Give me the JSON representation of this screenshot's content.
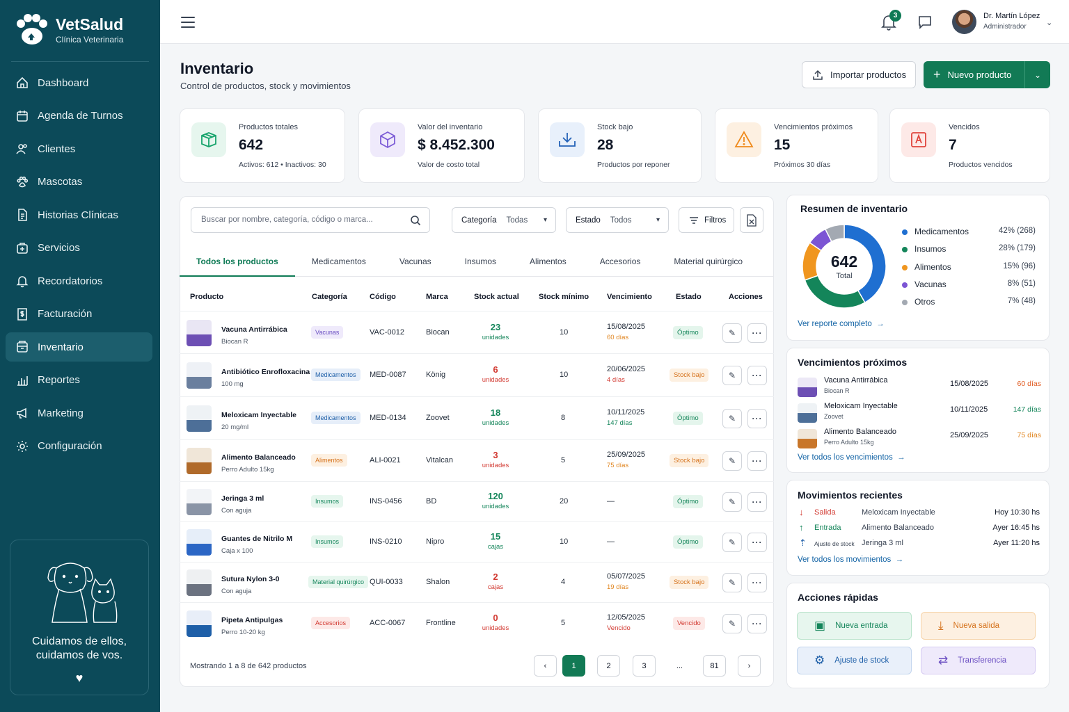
{
  "brand": {
    "name": "VetSalud",
    "subtitle": "Clínica Veterinaria"
  },
  "nav": [
    {
      "label": "Dashboard",
      "icon": "home-icon"
    },
    {
      "label": "Agenda de Turnos",
      "icon": "calendar-icon"
    },
    {
      "label": "Clientes",
      "icon": "users-icon"
    },
    {
      "label": "Mascotas",
      "icon": "paw-icon"
    },
    {
      "label": "Historias Clínicas",
      "icon": "document-icon"
    },
    {
      "label": "Servicios",
      "icon": "medical-plus-icon"
    },
    {
      "label": "Recordatorios",
      "icon": "bell-icon"
    },
    {
      "label": "Facturación",
      "icon": "invoice-icon"
    },
    {
      "label": "Inventario",
      "icon": "inventory-icon",
      "active": true
    },
    {
      "label": "Reportes",
      "icon": "bar-chart-icon"
    },
    {
      "label": "Marketing",
      "icon": "megaphone-icon"
    },
    {
      "label": "Configuración",
      "icon": "gear-icon"
    }
  ],
  "promo": {
    "text": "Cuidamos de ellos, cuidamos de vos."
  },
  "header": {
    "notifications": "3",
    "user_name": "Dr. Martín López",
    "user_role": "Administrador"
  },
  "page": {
    "title": "Inventario",
    "subtitle": "Control de productos, stock y movimientos",
    "import_label": "Importar productos",
    "new_label": "Nuevo producto"
  },
  "stats": [
    {
      "label": "Productos totales",
      "value": "642",
      "note": "Activos: 612 • Inactivos: 30",
      "icon": "box-icon",
      "color": "#16a36b",
      "bg": "#e6f6ee"
    },
    {
      "label": "Valor del inventario",
      "value": "$ 8.452.300",
      "note": "Valor de costo total",
      "icon": "cube-icon",
      "color": "#7c5cd6",
      "bg": "#efeafb"
    },
    {
      "label": "Stock bajo",
      "value": "28",
      "note": "Productos por reponer",
      "icon": "download-tray-icon",
      "color": "#2563b8",
      "bg": "#e8f0fb"
    },
    {
      "label": "Vencimientos próximos",
      "value": "15",
      "note": "Próximos 30 días",
      "icon": "warning-icon",
      "color": "#ef8a1c",
      "bg": "#fdf0e1"
    },
    {
      "label": "Vencidos",
      "value": "7",
      "note": "Productos vencidos",
      "icon": "expired-calendar-icon",
      "color": "#e0443c",
      "bg": "#fde9e7"
    }
  ],
  "filters": {
    "search_placeholder": "Buscar por nombre, categoría, código o marca...",
    "category_label": "Categoría",
    "category_value": "Todas",
    "status_label": "Estado",
    "status_value": "Todos",
    "filters_label": "Filtros"
  },
  "tabs": [
    "Todos los productos",
    "Medicamentos",
    "Vacunas",
    "Insumos",
    "Alimentos",
    "Accesorios",
    "Material quirúrgico"
  ],
  "columns": [
    "Producto",
    "Categoría",
    "Código",
    "Marca",
    "Stock actual",
    "Stock mínimo",
    "Vencimiento",
    "Estado",
    "Acciones"
  ],
  "products": [
    {
      "name": "Vacuna Antirrábica",
      "sub": "Biocan R",
      "category": "Vacunas",
      "code": "VAC-0012",
      "brand": "Biocan",
      "stock": "23",
      "unit": "unidades",
      "min": "10",
      "exp": "15/08/2025",
      "exp_note": "60 días",
      "status": "Óptimo",
      "stock_level": "ok",
      "exp_level": "warn",
      "cat_color": "#6b4fc2",
      "cat_bg": "#efeafb"
    },
    {
      "name": "Antibiótico Enrofloxacina",
      "sub": "100 mg",
      "category": "Medicamentos",
      "code": "MED-0087",
      "brand": "König",
      "stock": "6",
      "unit": "unidades",
      "min": "10",
      "exp": "20/06/2025",
      "exp_note": "4 días",
      "status": "Stock bajo",
      "stock_level": "low",
      "exp_level": "danger",
      "cat_color": "#1e5fa8",
      "cat_bg": "#e6eef9"
    },
    {
      "name": "Meloxicam Inyectable",
      "sub": "20 mg/ml",
      "category": "Medicamentos",
      "code": "MED-0134",
      "brand": "Zoovet",
      "stock": "18",
      "unit": "unidades",
      "min": "8",
      "exp": "10/11/2025",
      "exp_note": "147 días",
      "status": "Óptimo",
      "stock_level": "ok",
      "exp_level": "ok",
      "cat_color": "#1e5fa8",
      "cat_bg": "#e6eef9"
    },
    {
      "name": "Alimento Balanceado",
      "sub": "Perro Adulto 15kg",
      "category": "Alimentos",
      "code": "ALI-0021",
      "brand": "Vitalcan",
      "stock": "3",
      "unit": "unidades",
      "min": "5",
      "exp": "25/09/2025",
      "exp_note": "75 días",
      "status": "Stock bajo",
      "stock_level": "low",
      "exp_level": "warn",
      "cat_color": "#d5711a",
      "cat_bg": "#fdf0e1"
    },
    {
      "name": "Jeringa 3 ml",
      "sub": "Con aguja",
      "category": "Insumos",
      "code": "INS-0456",
      "brand": "BD",
      "stock": "120",
      "unit": "unidades",
      "min": "20",
      "exp": "—",
      "exp_note": "",
      "status": "Óptimo",
      "stock_level": "ok",
      "exp_level": "ok",
      "cat_color": "#15865c",
      "cat_bg": "#e6f6ee"
    },
    {
      "name": "Guantes de Nitrilo M",
      "sub": "Caja x 100",
      "category": "Insumos",
      "code": "INS-0210",
      "brand": "Nipro",
      "stock": "15",
      "unit": "cajas",
      "min": "10",
      "exp": "—",
      "exp_note": "",
      "status": "Óptimo",
      "stock_level": "ok",
      "exp_level": "ok",
      "cat_color": "#15865c",
      "cat_bg": "#e6f6ee"
    },
    {
      "name": "Sutura Nylon 3-0",
      "sub": "Con aguja",
      "category": "Material quirúrgico",
      "code": "QUI-0033",
      "brand": "Shalon",
      "stock": "2",
      "unit": "cajas",
      "min": "4",
      "exp": "05/07/2025",
      "exp_note": "19 días",
      "status": "Stock bajo",
      "stock_level": "low",
      "exp_level": "warn",
      "cat_color": "#15865c",
      "cat_bg": "#e6f6ee"
    },
    {
      "name": "Pipeta Antipulgas",
      "sub": "Perro 10-20 kg",
      "category": "Accesorios",
      "code": "ACC-0067",
      "brand": "Frontline",
      "stock": "0",
      "unit": "unidades",
      "min": "5",
      "exp": "12/05/2025",
      "exp_note": "Vencido",
      "status": "Vencido",
      "stock_level": "low",
      "exp_level": "danger",
      "cat_color": "#d23a32",
      "cat_bg": "#fde9e7"
    }
  ],
  "table_footer": "Mostrando 1 a 8 de 642 productos",
  "pagination": [
    "‹",
    "1",
    "2",
    "3",
    "...",
    "81",
    "›"
  ],
  "summary": {
    "title": "Resumen de inventario",
    "total": "642",
    "total_label": "Total",
    "link": "Ver reporte completo",
    "chart_data": {
      "type": "pie",
      "categories": [
        "Medicamentos",
        "Insumos",
        "Alimentos",
        "Vacunas",
        "Otros"
      ],
      "values": [
        268,
        179,
        96,
        51,
        48
      ],
      "labels": [
        "42% (268)",
        "28% (179)",
        "15% (96)",
        "8% (51)",
        "7% (48)"
      ],
      "colors": [
        "#1f6fd1",
        "#14855a",
        "#f0961f",
        "#7c55d4",
        "#a3a9b2"
      ]
    }
  },
  "upcoming": {
    "title": "Vencimientos próximos",
    "items": [
      {
        "name": "Vacuna Antirrábica",
        "sub": "Biocan R",
        "date": "15/08/2025",
        "days": "60 días",
        "color": "#e0591f"
      },
      {
        "name": "Meloxicam Inyectable",
        "sub": "Zoovet",
        "date": "10/11/2025",
        "days": "147 días",
        "color": "#14855a"
      },
      {
        "name": "Alimento Balanceado",
        "sub": "Perro Adulto 15kg",
        "date": "25/09/2025",
        "days": "75 días",
        "color": "#e0851f"
      }
    ],
    "link": "Ver todos los vencimientos"
  },
  "movements": {
    "title": "Movimientos recientes",
    "items": [
      {
        "type": "Salida",
        "product": "Meloxicam Inyectable",
        "time": "Hoy 10:30 hs",
        "color": "#d23a32",
        "icon": "arrow-down-out-icon"
      },
      {
        "type": "Entrada",
        "product": "Alimento Balanceado",
        "time": "Ayer 16:45 hs",
        "color": "#14855a",
        "icon": "arrow-up-in-icon"
      },
      {
        "type": "Ajuste de stock",
        "product": "Jeringa 3 ml",
        "time": "Ayer 11:20 hs",
        "color": "#1e5fa8",
        "icon": "adjust-icon"
      }
    ],
    "link": "Ver todos los movimientos"
  },
  "quick": {
    "title": "Acciones rápidas",
    "actions": [
      {
        "label": "Nueva entrada",
        "color": "#14855a",
        "bg": "#e7f6ee",
        "border": "#b9e3cb",
        "icon": "inbox-in-icon"
      },
      {
        "label": "Nueva salida",
        "color": "#d5711a",
        "bg": "#fdf0e1",
        "border": "#f6d3a8",
        "icon": "download-icon"
      },
      {
        "label": "Ajuste de stock",
        "color": "#1e5fa8",
        "bg": "#e9f0fa",
        "border": "#c4d6ee",
        "icon": "adjust-box-icon"
      },
      {
        "label": "Transferencia",
        "color": "#6b4fc2",
        "bg": "#efeafb",
        "border": "#d6cbf2",
        "icon": "transfer-icon"
      }
    ]
  }
}
